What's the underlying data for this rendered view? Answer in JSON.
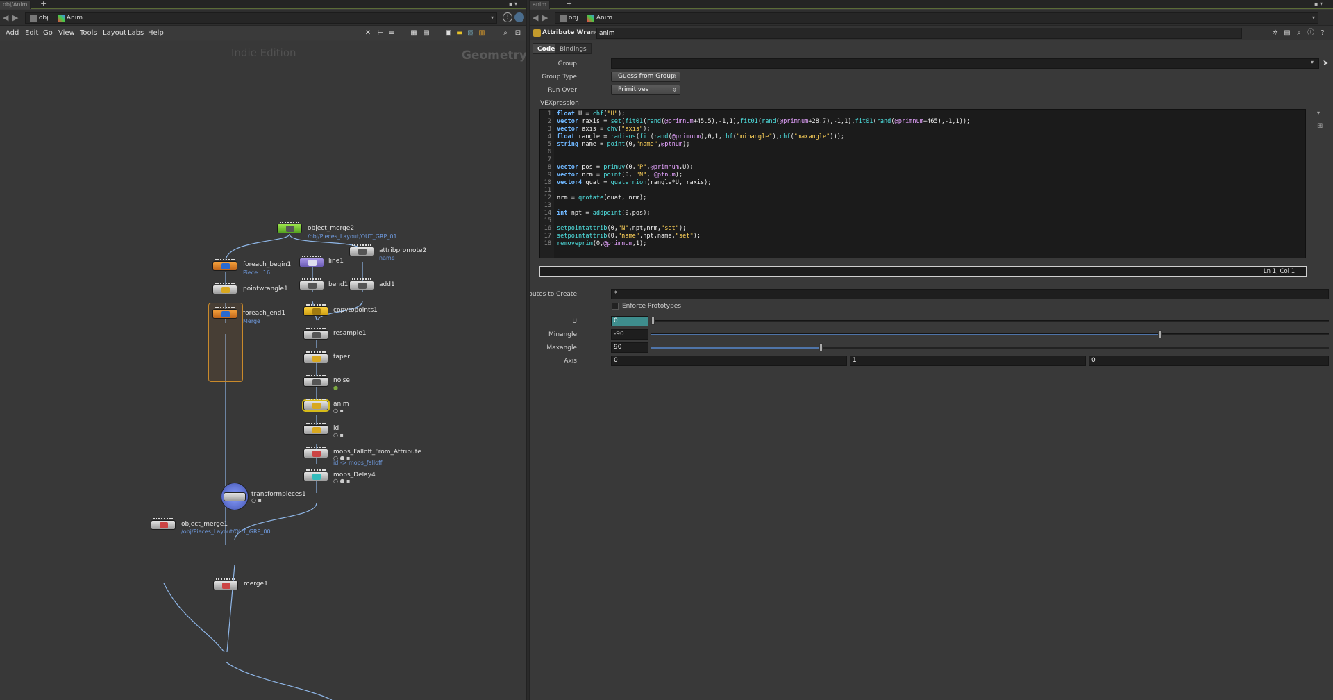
{
  "left": {
    "tab_title": "obj/Anim",
    "path": {
      "seg1": "obj",
      "seg2": "Anim"
    },
    "menu": [
      "Add",
      "Edit",
      "Go",
      "View",
      "Tools",
      "Layout",
      "Labs",
      "Help"
    ],
    "network": {
      "watermark": "Indie Edition",
      "context": "Geometry",
      "nodes": {
        "object_merge2": {
          "label": "object_merge2",
          "sub": "/obj/Pieces_Layout/OUT_GRP_01"
        },
        "attribpromote2": {
          "label": "attribpromote2",
          "sub": "name"
        },
        "foreach_begin1": {
          "label": "foreach_begin1",
          "sub": "Piece : 16"
        },
        "pointwrangle1": {
          "label": "pointwrangle1"
        },
        "foreach_end1": {
          "label": "foreach_end1",
          "sub": "Merge"
        },
        "line1": {
          "label": "line1"
        },
        "bend1": {
          "label": "bend1"
        },
        "add1": {
          "label": "add1"
        },
        "copytopoints1": {
          "label": "copytopoints1"
        },
        "resample1": {
          "label": "resample1"
        },
        "taper": {
          "label": "taper"
        },
        "noise": {
          "label": "noise"
        },
        "anim": {
          "label": "anim"
        },
        "id": {
          "label": "id"
        },
        "mops_falloff": {
          "label": "mops_Falloff_From_Attribute",
          "sub": "id -> mops_falloff"
        },
        "mops_delay4": {
          "label": "mops_Delay4"
        },
        "transformpieces1": {
          "label": "transformpieces1"
        },
        "object_merge1": {
          "label": "object_merge1",
          "sub": "/obj/Pieces_Layout/OUT_GRP_00"
        },
        "merge1": {
          "label": "merge1"
        }
      }
    }
  },
  "right": {
    "tab_title": "anim",
    "path": {
      "seg1": "obj",
      "seg2": "Anim"
    },
    "header": {
      "op_type": "Attribute Wrangle",
      "op_name": "anim"
    },
    "tabs": [
      "Code",
      "Bindings"
    ],
    "params": {
      "group": {
        "label": "Group",
        "value": ""
      },
      "group_type": {
        "label": "Group Type",
        "value": "Guess from Group"
      },
      "run_over": {
        "label": "Run Over",
        "value": "Primitives"
      },
      "vexpression_label": "VEXpression",
      "status_pos": "Ln 1, Col 1",
      "attributes_to_create": {
        "label": "Attributes to Create",
        "value": "*"
      },
      "enforce_prototypes": {
        "label": "Enforce Prototypes",
        "checked": false
      },
      "u": {
        "label": "U",
        "value": "0",
        "fraction": 0.0
      },
      "minangle": {
        "label": "Minangle",
        "value": "-90",
        "fraction": 0.75
      },
      "maxangle": {
        "label": "Maxangle",
        "value": "90",
        "fraction": 0.25
      },
      "axis": {
        "label": "Axis",
        "x": "0",
        "y": "1",
        "z": "0"
      }
    }
  }
}
